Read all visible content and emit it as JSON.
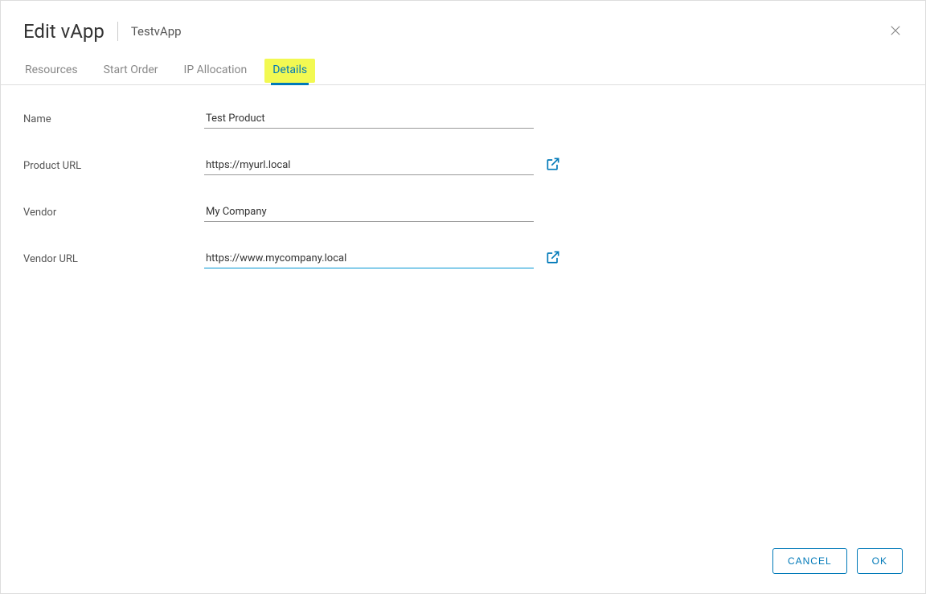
{
  "header": {
    "title": "Edit vApp",
    "subtitle": "TestvApp"
  },
  "tabs": [
    {
      "label": "Resources",
      "active": false
    },
    {
      "label": "Start Order",
      "active": false
    },
    {
      "label": "IP Allocation",
      "active": false
    },
    {
      "label": "Details",
      "active": true,
      "highlighted": true
    }
  ],
  "form": {
    "name": {
      "label": "Name",
      "value": "Test Product"
    },
    "product_url": {
      "label": "Product URL",
      "value": "https://myurl.local"
    },
    "vendor": {
      "label": "Vendor",
      "value": "My Company"
    },
    "vendor_url": {
      "label": "Vendor URL",
      "value": "https://www.mycompany.local"
    }
  },
  "footer": {
    "cancel": "CANCEL",
    "ok": "OK"
  }
}
